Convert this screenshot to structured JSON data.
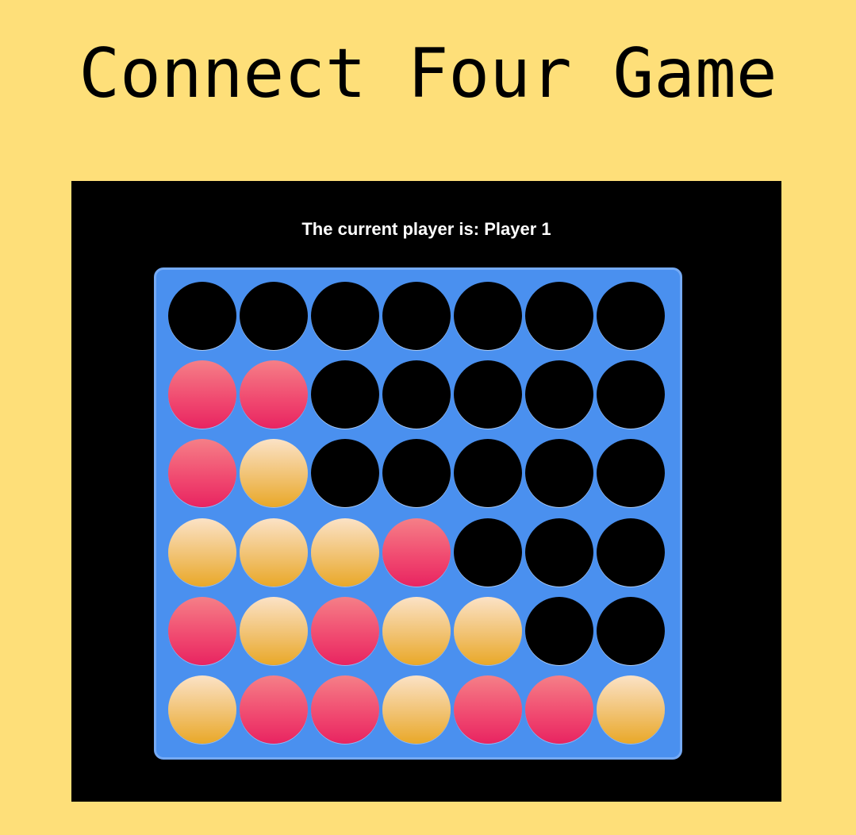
{
  "title": "Connect Four Game",
  "status": {
    "prefix": "The current player is:",
    "player": "Player 1"
  },
  "colors": {
    "background": "#fedf79",
    "panel": "#000000",
    "board": "#4a90ef",
    "red_disc": "#f0476f",
    "yellow_disc": "#f1c271",
    "empty_slot": "#000000"
  },
  "board": {
    "rows": 6,
    "columns": 7,
    "cells": [
      [
        "empty",
        "empty",
        "empty",
        "empty",
        "empty",
        "empty",
        "empty"
      ],
      [
        "red",
        "red",
        "empty",
        "empty",
        "empty",
        "empty",
        "empty"
      ],
      [
        "red",
        "yellow",
        "empty",
        "empty",
        "empty",
        "empty",
        "empty"
      ],
      [
        "yellow",
        "yellow",
        "yellow",
        "red",
        "empty",
        "empty",
        "empty"
      ],
      [
        "red",
        "yellow",
        "red",
        "yellow",
        "yellow",
        "empty",
        "empty"
      ],
      [
        "yellow",
        "red",
        "red",
        "yellow",
        "red",
        "red",
        "yellow"
      ]
    ]
  }
}
